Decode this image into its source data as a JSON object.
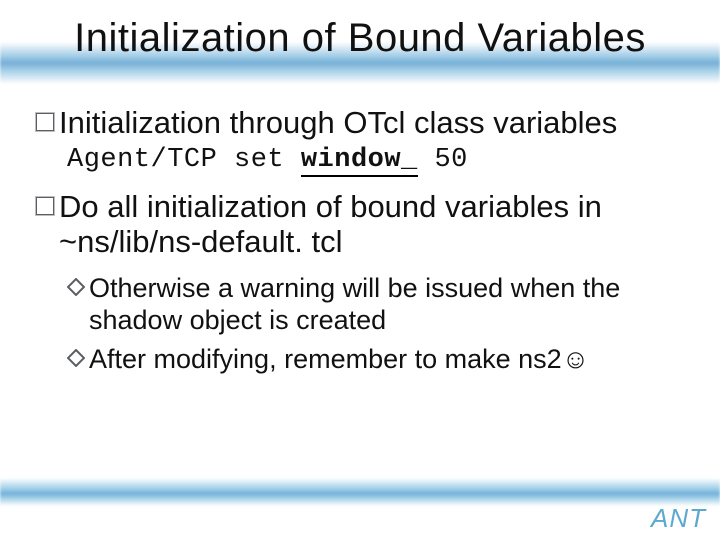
{
  "title": "Initialization of Bound Variables",
  "bullets": {
    "b1": {
      "text": "Initialization through OTcl class variables",
      "code_pre": "Agent/TCP set ",
      "code_kw": "window_",
      "code_post": " 50"
    },
    "b2": {
      "text": "Do all initialization of bound variables in ~ns/lib/ns-default. tcl",
      "sub": {
        "s1": "Otherwise a warning will be issued when the shadow object is created",
        "s2_pre": "After modifying, remember to make ns2",
        "s2_smile": "☺"
      }
    }
  },
  "logo": "ANT"
}
